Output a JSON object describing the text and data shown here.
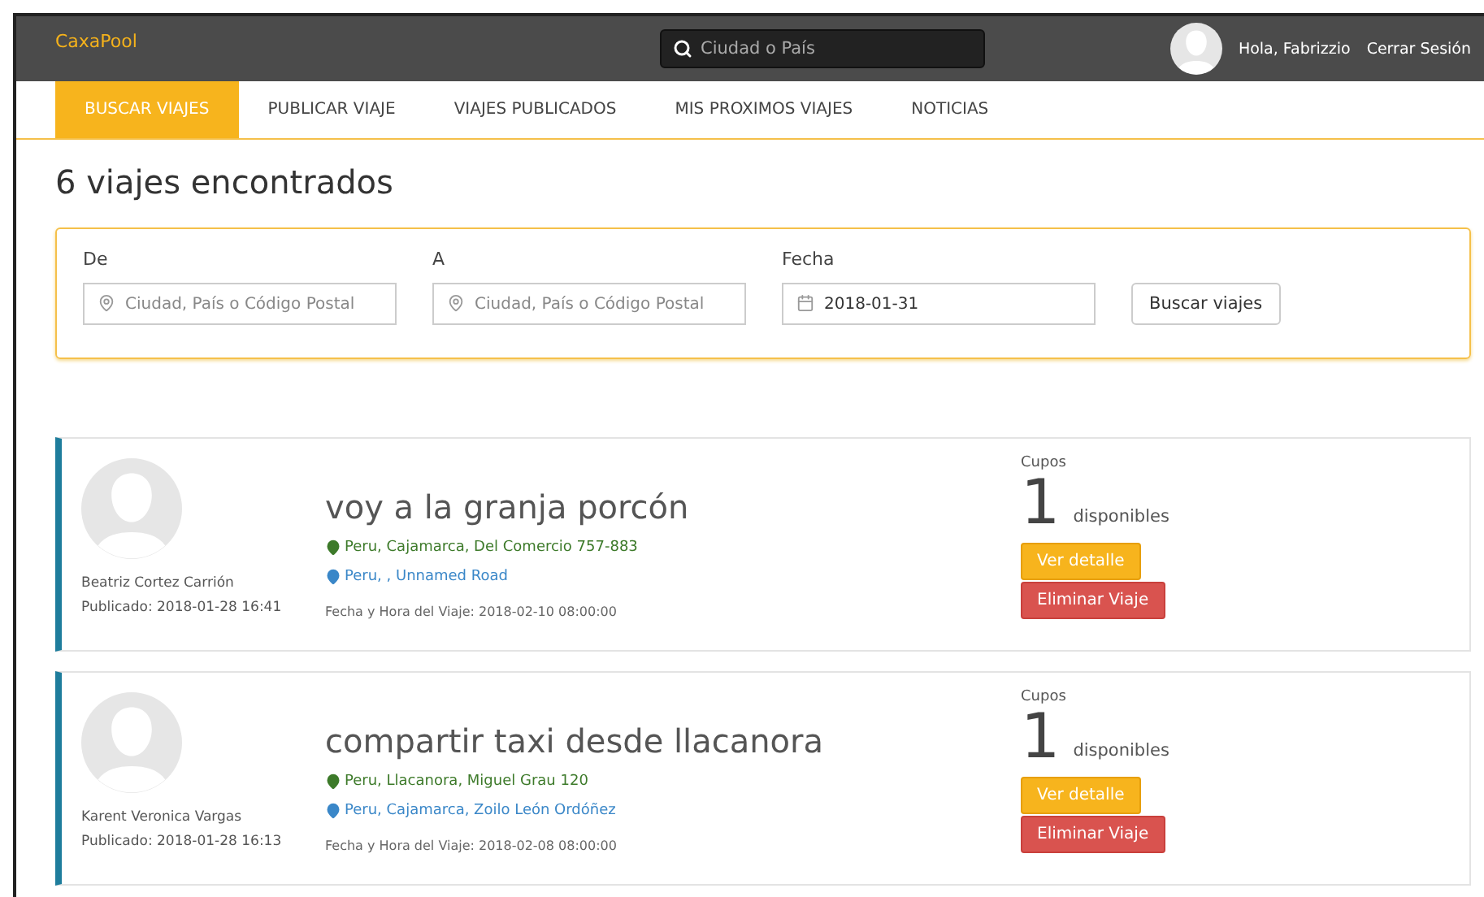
{
  "header": {
    "brand": "CaxaPool",
    "search": {
      "placeholder": "Ciudad o País"
    },
    "greeting": "Hola, Fabrizzio",
    "logout": "Cerrar Sesión"
  },
  "tabs": [
    {
      "label": "BUSCAR VIAJES",
      "selected": true
    },
    {
      "label": "PUBLICAR VIAJE",
      "selected": false
    },
    {
      "label": "VIAJES PUBLICADOS",
      "selected": false
    },
    {
      "label": "MIS PROXIMOS VIAJES",
      "selected": false
    },
    {
      "label": "NOTICIAS",
      "selected": false
    }
  ],
  "heading": "6 viajes encontrados",
  "filters": {
    "fields": [
      {
        "label": "De",
        "kind": "place",
        "placeholder": "Ciudad, País o Código Postal"
      },
      {
        "label": "A",
        "kind": "place",
        "placeholder": "Ciudad, País o Código Postal"
      },
      {
        "label": "Fecha",
        "kind": "date",
        "value": "2018-01-31"
      }
    ],
    "button": "Buscar viajes"
  },
  "trips": [
    {
      "driver": "Beatriz Cortez Carrión",
      "published": "Publicado: 2018-01-28 16:41",
      "title": "voy a la granja porcón",
      "origin": "Peru, Cajamarca, Del Comercio 757-883",
      "destination": "Peru, , Unnamed Road",
      "datetime": "Fecha y Hora del Viaje: 2018-02-10 08:00:00",
      "seats_label": "Cupos",
      "seats": "1",
      "seats_suffix": "disponibles",
      "buttons": [
        "Ver detalle",
        "Eliminar Viaje"
      ]
    },
    {
      "driver": "Karent Veronica Vargas",
      "published": "Publicado: 2018-01-28 16:13",
      "title": "compartir taxi desde llacanora",
      "origin": "Peru, Llacanora, Miguel Grau 120",
      "destination": "Peru, Cajamarca, Zoilo León Ordóñez",
      "datetime": "Fecha y Hora del Viaje: 2018-02-08 08:00:00",
      "seats_label": "Cupos",
      "seats": "1",
      "seats_suffix": "disponibles",
      "buttons": [
        "Ver detalle",
        "Eliminar Viaje"
      ]
    }
  ]
}
